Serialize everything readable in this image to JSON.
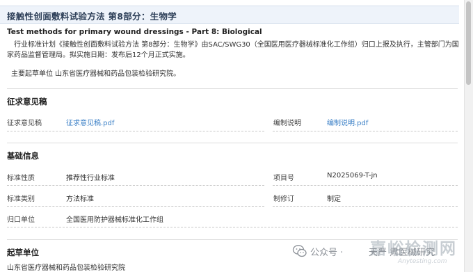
{
  "header": {
    "title": "接触性创面敷料试验方法 第8部分：生物学"
  },
  "english_title": "Test methods for primary wound dressings - Part 8: Biological",
  "plan_text": "行业标准计划《接触性创面敷料试验方法 第8部分：生物学》由SAC/SWG30（全国医用医疗器械标准化工作组）归口上报及执行，主管部门为国家药品监督管理局。拟实施日期：发布后12个月正式实施。",
  "drafter_text": "主要起草单位 山东省医疗器械和药品包装检验研究院。",
  "comments": {
    "title": "征求意见稿",
    "draft_label": "征求意见稿",
    "draft_file": "征求意见稿.pdf",
    "notes_label": "编制说明",
    "notes_file": "编制说明.pdf"
  },
  "basic_info": {
    "title": "基础信息",
    "nature_label": "标准性质",
    "nature_value": "推荐性行业标准",
    "project_label": "项目号",
    "project_value": "N2025069-T-jn",
    "category_label": "标准类别",
    "category_value": "方法标准",
    "revision_label": "制修订",
    "revision_value": "制定",
    "unit_label": "归口单位",
    "unit_value": "全国医用防护器械标准化工作组"
  },
  "drafting_unit": {
    "title": "起草单位",
    "value": "山东省医疗器械和药品包装检验研究院"
  },
  "watermark": {
    "main": "嘉峪检测网",
    "sub": "Anytesting.com",
    "account": "公众号 ·",
    "account_name": "天严 肃医械研究"
  },
  "icons": {
    "wechat": "wechat-icon"
  },
  "colors": {
    "link": "#3a7fc6",
    "header_bg": "#eef3fa"
  }
}
